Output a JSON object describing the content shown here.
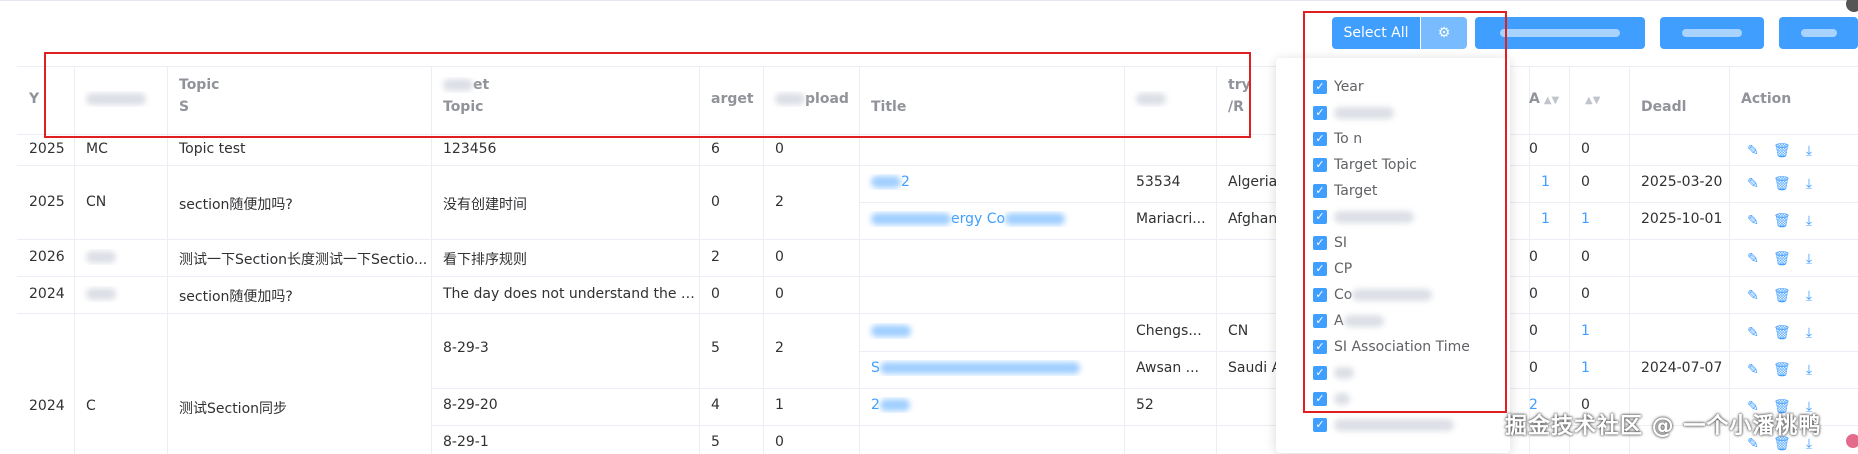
{
  "toolbar": {
    "select_all": "Select All",
    "gear_icon": "gear-icon"
  },
  "table": {
    "headers": {
      "year": "Y",
      "topic_line1": "Topic",
      "topic_line2": "S",
      "target_topic_line1": "et",
      "target_topic_line2": "Topic",
      "target": "arget",
      "upload": "pload",
      "title": "Title",
      "country_region": "/R",
      "country_try": "try",
      "col_a": "A",
      "deadline": "Deadl",
      "action": "Action"
    },
    "rows": [
      {
        "year": "2025",
        "org": "MC",
        "topic": "Topic test",
        "target_topic": "123456",
        "target": "6",
        "upload": "0",
        "col_a": "0",
        "col_b": "0"
      },
      {
        "year": "2025",
        "org": "CN",
        "topic": "section随便加吗?",
        "target_topic": "没有创建时间",
        "target": "0",
        "upload": "2",
        "sub": [
          {
            "title": "2",
            "code": "53534",
            "country": "Algeria",
            "col_a": "1",
            "col_b": "0",
            "deadline": "2025-03-20"
          },
          {
            "title": "ergy Co",
            "code": "Mariacri...",
            "country": "Afghani",
            "col_a": "1",
            "col_b": "1",
            "deadline": "2025-10-01"
          }
        ]
      },
      {
        "year": "2026",
        "org": "",
        "topic": "测试一下Section长度测试一下Sectio...",
        "target_topic": "看下排序规则",
        "target": "2",
        "upload": "0",
        "col_a": "0",
        "col_b": "0"
      },
      {
        "year": "2024",
        "org": "",
        "topic": "section随便加吗?",
        "target_topic": "The day does not understand the dar...",
        "target": "0",
        "upload": "0",
        "col_a": "0",
        "col_b": "0"
      },
      {
        "year": "2024",
        "org": "C",
        "topic": "测试Section同步",
        "sub": [
          {
            "target_topic": "8-29-3",
            "target": "5",
            "upload": "2",
            "title": "test sl",
            "code": "Chengs...",
            "country": "CN",
            "col_a": "0",
            "col_b": "1",
            "deadline": ""
          },
          {
            "target_topic": "",
            "target": "",
            "upload": "",
            "title": "S",
            "code": "Awsan ...",
            "country": "Saudi A",
            "col_a": "0",
            "col_b": "1",
            "deadline": "2024-07-07"
          },
          {
            "target_topic": "8-29-20",
            "target": "4",
            "upload": "1",
            "title": "2",
            "code": "52",
            "country": "",
            "col_a": "2",
            "col_b": "0",
            "deadline": ""
          },
          {
            "target_topic": "8-29-1",
            "target": "5",
            "upload": "0",
            "title": "",
            "code": "",
            "country": "",
            "col_a": "",
            "col_b": "",
            "deadline": ""
          }
        ]
      }
    ]
  },
  "dropdown": {
    "options": [
      "Year",
      "",
      "To          n",
      "Target Topic",
      "Target",
      "",
      "SI",
      "CP",
      "Co",
      "A",
      "SI Association Time",
      "",
      "",
      ""
    ]
  },
  "watermark": "掘金技术社区 @ 一个小潘桃鸭",
  "colors": {
    "primary": "#409eff",
    "border": "#ebeef5",
    "highlight": "#e02020"
  }
}
